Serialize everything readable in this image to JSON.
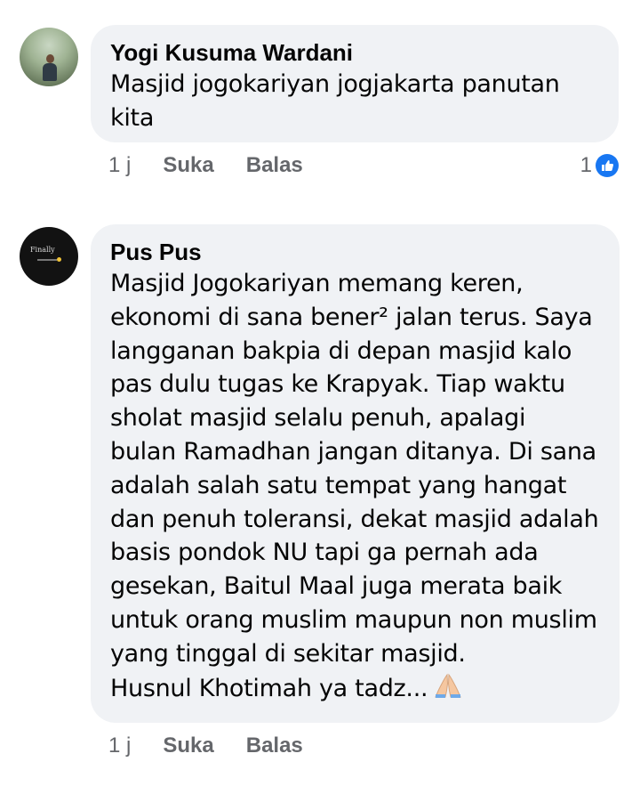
{
  "comments": [
    {
      "author": "Yogi Kusuma Wardani",
      "text": "Masjid jogokariyan jogjakarta panutan\nkita",
      "time": "1 j",
      "like_label": "Suka",
      "reply_label": "Balas",
      "reaction_count": "1",
      "reaction_icon": "like-icon"
    },
    {
      "author": "Pus Pus",
      "avatar_text": "Finally",
      "text": "Masjid Jogokariyan memang keren,\nekonomi di sana bener² jalan terus. Saya\nlangganan bakpia di depan masjid kalo\npas dulu tugas ke Krapyak. Tiap waktu\nsholat masjid selalu penuh, apalagi\nbulan Ramadhan jangan ditanya. Di sana\nadalah salah satu tempat yang hangat\ndan penuh toleransi, dekat masjid adalah\nbasis pondok NU tapi ga pernah ada\ngesekan, Baitul Maal juga merata baik\nuntuk orang muslim maupun non muslim\nyang tinggal di sekitar masjid.\nHusnul Khotimah ya tadz...",
      "emoji": "folded-hands-icon",
      "time": "1 j",
      "like_label": "Suka",
      "reply_label": "Balas"
    }
  ],
  "colors": {
    "bubble": "#f0f2f5",
    "meta_text": "#65676b",
    "like_blue": "#1877f2"
  }
}
